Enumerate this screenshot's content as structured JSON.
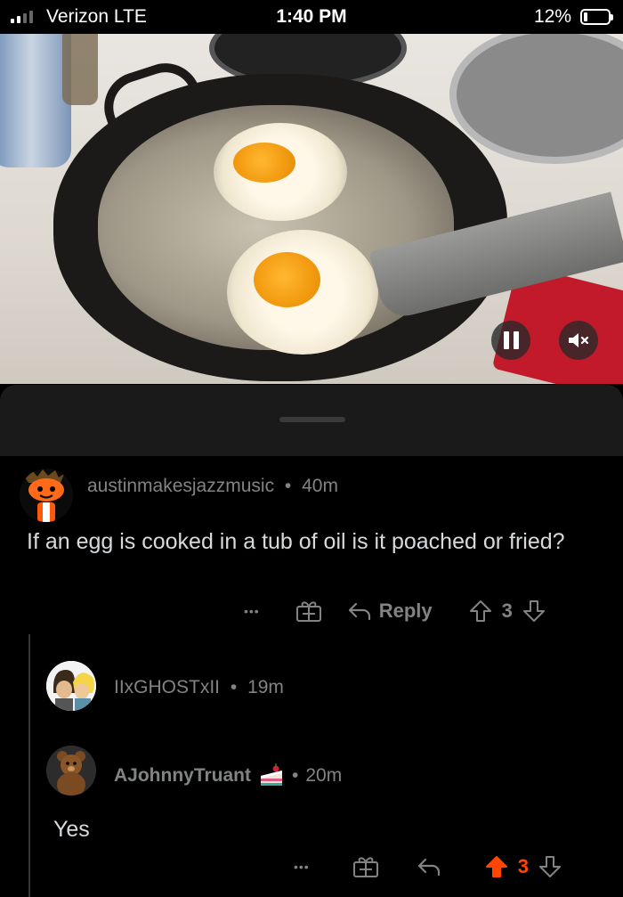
{
  "status_bar": {
    "carrier": "Verizon  LTE",
    "time": "1:40 PM",
    "battery_percent": "12%",
    "signal_bars": 2
  },
  "video": {
    "pause_icon": "pause-icon",
    "mute_icon": "mute-icon"
  },
  "comments": [
    {
      "username": "austinmakesjazzmusic",
      "separator": "•",
      "age": "40m",
      "body": "If an egg is cooked in a tub of oil is it poached or fried?",
      "more": "•••",
      "reply_label": "Reply",
      "score": "3"
    },
    {
      "username": "IIxGHOSTxII",
      "separator": "•",
      "age": "19m"
    },
    {
      "username": "AJohnnyTruant",
      "separator": "•",
      "age": "20m",
      "body": "Yes",
      "more": "•••",
      "score": "3",
      "upvoted": true
    }
  ],
  "colors": {
    "background": "#000000",
    "meta_text": "#818384",
    "body_text": "#d7dadc",
    "upvote": "#ff4500"
  }
}
